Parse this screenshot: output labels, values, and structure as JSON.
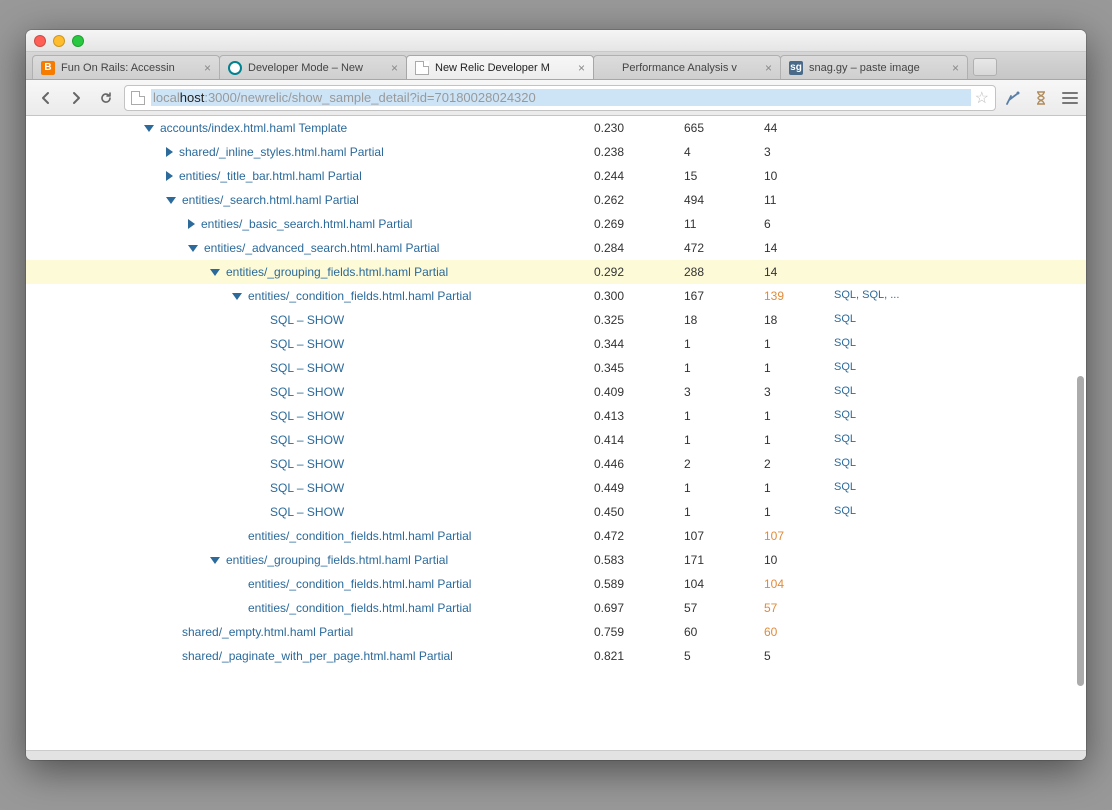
{
  "window": {
    "traffic_lights": [
      "close",
      "minimize",
      "maximize"
    ]
  },
  "tabs": [
    {
      "title": "Fun On Rails: Accessin",
      "active": false,
      "favicon": "blogger"
    },
    {
      "title": "Developer Mode – New",
      "active": false,
      "favicon": "newrelic"
    },
    {
      "title": "New Relic Developer M",
      "active": true,
      "favicon": "page"
    },
    {
      "title": "Performance Analysis v",
      "active": false,
      "favicon": "dots"
    },
    {
      "title": "snag.gy – paste image",
      "active": false,
      "favicon": "sg"
    }
  ],
  "url": {
    "host_muted": "local",
    "host_main": "host",
    "host_port": ":3000",
    "path": "/newrelic/show_sample_detail?id=70180028024320"
  },
  "trace_rows": [
    {
      "indent": 0,
      "toggle": "expanded",
      "name": "accounts/index.html.haml Template",
      "ts": "0.230",
      "dur": "665",
      "excl": "44",
      "link": "",
      "hl": false
    },
    {
      "indent": 1,
      "toggle": "collapsed",
      "name": "shared/_inline_styles.html.haml Partial",
      "ts": "0.238",
      "dur": "4",
      "excl": "3",
      "link": "",
      "hl": false
    },
    {
      "indent": 1,
      "toggle": "collapsed",
      "name": "entities/_title_bar.html.haml Partial",
      "ts": "0.244",
      "dur": "15",
      "excl": "10",
      "link": "",
      "hl": false
    },
    {
      "indent": 1,
      "toggle": "expanded",
      "name": "entities/_search.html.haml Partial",
      "ts": "0.262",
      "dur": "494",
      "excl": "11",
      "link": "",
      "hl": false
    },
    {
      "indent": 2,
      "toggle": "collapsed",
      "name": "entities/_basic_search.html.haml Partial",
      "ts": "0.269",
      "dur": "11",
      "excl": "6",
      "link": "",
      "hl": false
    },
    {
      "indent": 2,
      "toggle": "expanded",
      "name": "entities/_advanced_search.html.haml Partial",
      "ts": "0.284",
      "dur": "472",
      "excl": "14",
      "link": "",
      "hl": false
    },
    {
      "indent": 3,
      "toggle": "expanded",
      "name": "entities/_grouping_fields.html.haml Partial",
      "ts": "0.292",
      "dur": "288",
      "excl": "14",
      "link": "",
      "hl": true
    },
    {
      "indent": 4,
      "toggle": "expanded",
      "name": "entities/_condition_fields.html.haml Partial",
      "ts": "0.300",
      "dur": "167",
      "excl": "139",
      "excl_orange": true,
      "link": "SQL, SQL, ...",
      "hl": false
    },
    {
      "indent": 5,
      "toggle": "none",
      "name": "SQL – SHOW",
      "ts": "0.325",
      "dur": "18",
      "excl": "18",
      "link": "SQL",
      "hl": false
    },
    {
      "indent": 5,
      "toggle": "none",
      "name": "SQL – SHOW",
      "ts": "0.344",
      "dur": "1",
      "excl": "1",
      "link": "SQL",
      "hl": false
    },
    {
      "indent": 5,
      "toggle": "none",
      "name": "SQL – SHOW",
      "ts": "0.345",
      "dur": "1",
      "excl": "1",
      "link": "SQL",
      "hl": false
    },
    {
      "indent": 5,
      "toggle": "none",
      "name": "SQL – SHOW",
      "ts": "0.409",
      "dur": "3",
      "excl": "3",
      "link": "SQL",
      "hl": false
    },
    {
      "indent": 5,
      "toggle": "none",
      "name": "SQL – SHOW",
      "ts": "0.413",
      "dur": "1",
      "excl": "1",
      "link": "SQL",
      "hl": false
    },
    {
      "indent": 5,
      "toggle": "none",
      "name": "SQL – SHOW",
      "ts": "0.414",
      "dur": "1",
      "excl": "1",
      "link": "SQL",
      "hl": false
    },
    {
      "indent": 5,
      "toggle": "none",
      "name": "SQL – SHOW",
      "ts": "0.446",
      "dur": "2",
      "excl": "2",
      "link": "SQL",
      "hl": false
    },
    {
      "indent": 5,
      "toggle": "none",
      "name": "SQL – SHOW",
      "ts": "0.449",
      "dur": "1",
      "excl": "1",
      "link": "SQL",
      "hl": false
    },
    {
      "indent": 5,
      "toggle": "none",
      "name": "SQL – SHOW",
      "ts": "0.450",
      "dur": "1",
      "excl": "1",
      "link": "SQL",
      "hl": false
    },
    {
      "indent": 4,
      "toggle": "none",
      "name": "entities/_condition_fields.html.haml Partial",
      "ts": "0.472",
      "dur": "107",
      "excl": "107",
      "excl_orange": true,
      "link": "",
      "hl": false
    },
    {
      "indent": 3,
      "toggle": "expanded",
      "name": "entities/_grouping_fields.html.haml Partial",
      "ts": "0.583",
      "dur": "171",
      "excl": "10",
      "link": "",
      "hl": false
    },
    {
      "indent": 4,
      "toggle": "none",
      "name": "entities/_condition_fields.html.haml Partial",
      "ts": "0.589",
      "dur": "104",
      "excl": "104",
      "excl_orange": true,
      "link": "",
      "hl": false
    },
    {
      "indent": 4,
      "toggle": "none",
      "name": "entities/_condition_fields.html.haml Partial",
      "ts": "0.697",
      "dur": "57",
      "excl": "57",
      "excl_orange": true,
      "link": "",
      "hl": false
    },
    {
      "indent": 1,
      "toggle": "none",
      "name": "shared/_empty.html.haml Partial",
      "ts": "0.759",
      "dur": "60",
      "excl": "60",
      "excl_orange": true,
      "link": "",
      "hl": false
    },
    {
      "indent": 1,
      "toggle": "none",
      "name": "shared/_paginate_with_per_page.html.haml Partial",
      "ts": "0.821",
      "dur": "5",
      "excl": "5",
      "link": "",
      "hl": false
    }
  ]
}
